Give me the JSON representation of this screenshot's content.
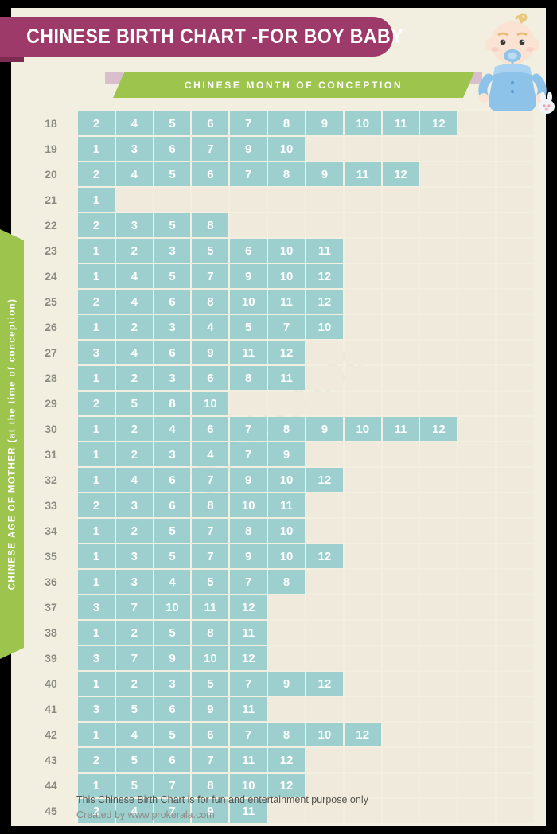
{
  "header": {
    "title": "CHINESE BIRTH CHART -FOR BOY BABY",
    "column_banner_label": "CHINESE   MONTH   OF   CONCEPTION",
    "row_axis_label": "CHINESE  AGE  OF  MOTHER (at the time of conception)",
    "baby_icon": "baby-boy-illustration"
  },
  "watermark": {
    "text": "prokerala"
  },
  "footer": {
    "disclaimer": "This Chinese Birth Chart is for fun and entertainment purpose only",
    "credit": "Created by www.prokerala.com"
  },
  "colors": {
    "title_banner": "#9e3a69",
    "ribbon_green": "#9dc44d",
    "cell_filled": "#9ecfcf",
    "cell_empty": "#efeadb",
    "sheet_background": "#f2eee0",
    "page_background": "#000000",
    "age_text": "#8a8a82"
  },
  "chart_data": {
    "type": "table",
    "title": "CHINESE BIRTH CHART -FOR BOY BABY",
    "xlabel": "CHINESE MONTH OF CONCEPTION",
    "ylabel": "CHINESE AGE OF MOTHER (at the time of conception)",
    "columns_per_row": 12,
    "description": "Each row lists the Chinese lunar conception months predicting a boy for that maternal age.",
    "rows": [
      {
        "age": "18",
        "months": [
          "2",
          "4",
          "5",
          "6",
          "7",
          "8",
          "9",
          "10",
          "11",
          "12"
        ]
      },
      {
        "age": "19",
        "months": [
          "1",
          "3",
          "6",
          "7",
          "9",
          "10"
        ]
      },
      {
        "age": "20",
        "months": [
          "2",
          "4",
          "5",
          "6",
          "7",
          "8",
          "9",
          "11",
          "12"
        ]
      },
      {
        "age": "21",
        "months": [
          "1"
        ]
      },
      {
        "age": "22",
        "months": [
          "2",
          "3",
          "5",
          "8"
        ]
      },
      {
        "age": "23",
        "months": [
          "1",
          "2",
          "3",
          "5",
          "6",
          "10",
          "11"
        ]
      },
      {
        "age": "24",
        "months": [
          "1",
          "4",
          "5",
          "7",
          "9",
          "10",
          "12"
        ]
      },
      {
        "age": "25",
        "months": [
          "2",
          "4",
          "6",
          "8",
          "10",
          "11",
          "12"
        ]
      },
      {
        "age": "26",
        "months": [
          "1",
          "2",
          "3",
          "4",
          "5",
          "7",
          "10"
        ]
      },
      {
        "age": "27",
        "months": [
          "3",
          "4",
          "6",
          "9",
          "11",
          "12"
        ]
      },
      {
        "age": "28",
        "months": [
          "1",
          "2",
          "3",
          "6",
          "8",
          "11"
        ]
      },
      {
        "age": "29",
        "months": [
          "2",
          "5",
          "8",
          "10"
        ]
      },
      {
        "age": "30",
        "months": [
          "1",
          "2",
          "4",
          "6",
          "7",
          "8",
          "9",
          "10",
          "11",
          "12"
        ]
      },
      {
        "age": "31",
        "months": [
          "1",
          "2",
          "3",
          "4",
          "7",
          "9"
        ]
      },
      {
        "age": "32",
        "months": [
          "1",
          "4",
          "6",
          "7",
          "9",
          "10",
          "12"
        ]
      },
      {
        "age": "33",
        "months": [
          "2",
          "3",
          "6",
          "8",
          "10",
          "11"
        ]
      },
      {
        "age": "34",
        "months": [
          "1",
          "2",
          "5",
          "7",
          "8",
          "10"
        ]
      },
      {
        "age": "35",
        "months": [
          "1",
          "3",
          "5",
          "7",
          "9",
          "10",
          "12"
        ]
      },
      {
        "age": "36",
        "months": [
          "1",
          "3",
          "4",
          "5",
          "7",
          "8"
        ]
      },
      {
        "age": "37",
        "months": [
          "3",
          "7",
          "10",
          "11",
          "12"
        ]
      },
      {
        "age": "38",
        "months": [
          "1",
          "2",
          "5",
          "8",
          "11"
        ]
      },
      {
        "age": "39",
        "months": [
          "3",
          "7",
          "9",
          "10",
          "12"
        ]
      },
      {
        "age": "40",
        "months": [
          "1",
          "2",
          "3",
          "5",
          "7",
          "9",
          "12"
        ]
      },
      {
        "age": "41",
        "months": [
          "3",
          "5",
          "6",
          "9",
          "11"
        ]
      },
      {
        "age": "42",
        "months": [
          "1",
          "4",
          "5",
          "6",
          "7",
          "8",
          "10",
          "12"
        ]
      },
      {
        "age": "43",
        "months": [
          "2",
          "5",
          "6",
          "7",
          "11",
          "12"
        ]
      },
      {
        "age": "44",
        "months": [
          "1",
          "5",
          "7",
          "8",
          "10",
          "12"
        ]
      },
      {
        "age": "45",
        "months": [
          "2",
          "4",
          "7",
          "9",
          "11"
        ]
      }
    ]
  }
}
